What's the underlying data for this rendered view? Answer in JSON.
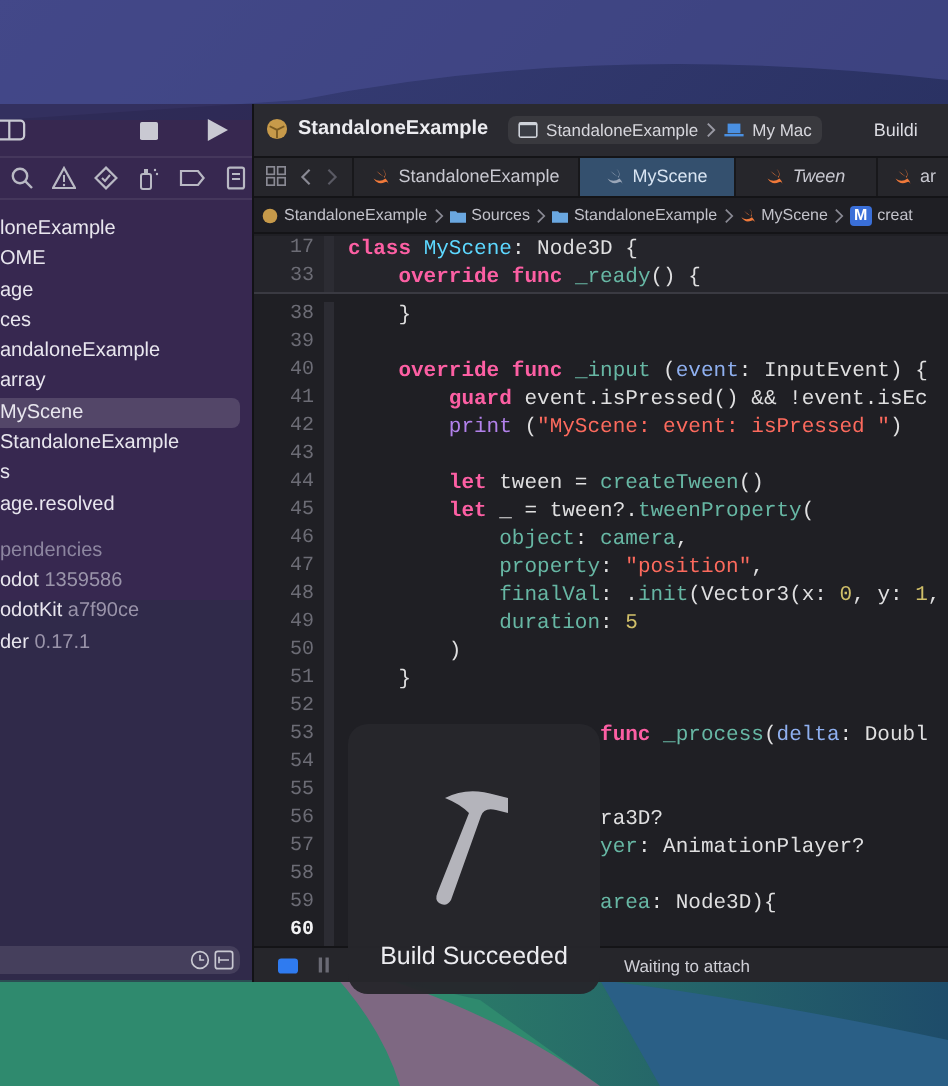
{
  "toolbar": {
    "project_title": "StandaloneExample",
    "scheme": "StandaloneExample",
    "destination": "My Mac",
    "status": "Buildi"
  },
  "navigator": {
    "items": [
      {
        "label": "loneExample",
        "selected": false
      },
      {
        "label": "OME",
        "selected": false
      },
      {
        "label": "age",
        "selected": false
      },
      {
        "label": "ces",
        "selected": false
      },
      {
        "label": "andaloneExample",
        "selected": false
      },
      {
        "label": "array",
        "selected": false
      },
      {
        "label": "MyScene",
        "selected": true
      },
      {
        "label": "StandaloneExample",
        "selected": false
      },
      {
        "label": "s",
        "selected": false
      },
      {
        "label": "age.resolved",
        "selected": false
      }
    ],
    "dependencies_header": "pendencies",
    "packages": [
      {
        "name": "odot",
        "version": "1359586"
      },
      {
        "name": "odotKit",
        "version": "a7f90ce"
      },
      {
        "name": "der",
        "version": "0.17.1"
      }
    ]
  },
  "tabs": [
    {
      "label": "StandaloneExample",
      "selected": false,
      "preview": false
    },
    {
      "label": "MyScene",
      "selected": true,
      "preview": false
    },
    {
      "label": "Tween",
      "selected": false,
      "preview": true
    },
    {
      "label": "ar",
      "selected": false,
      "preview": false
    }
  ],
  "jump_bar": [
    {
      "kind": "project",
      "label": "StandaloneExample"
    },
    {
      "kind": "folder",
      "label": "Sources"
    },
    {
      "kind": "folder",
      "label": "StandaloneExample"
    },
    {
      "kind": "swift",
      "label": "MyScene"
    },
    {
      "kind": "method",
      "badge": "M",
      "label": "creat"
    }
  ],
  "editor": {
    "sticky_lines": [
      {
        "number": "17",
        "tokens": [
          {
            "kind": "keyword",
            "text": "class"
          },
          {
            "kind": "decl",
            "text": " MyScene"
          },
          {
            "kind": "plain",
            "text": ": Node3D {"
          }
        ]
      },
      {
        "number": "33",
        "tokens": [
          {
            "kind": "keyword",
            "text": "    override"
          },
          {
            "kind": "keyword",
            "text": " func"
          },
          {
            "kind": "func",
            "text": " _ready"
          },
          {
            "kind": "plain",
            "text": "() {"
          }
        ]
      }
    ],
    "lines": [
      {
        "number": "38",
        "current": false,
        "tokens": [
          {
            "kind": "plain",
            "text": "    }"
          }
        ]
      },
      {
        "number": "39",
        "current": false
      },
      {
        "number": "40",
        "current": false,
        "tokens": [
          {
            "kind": "keyword",
            "text": "    override"
          },
          {
            "kind": "keyword",
            "text": " func"
          },
          {
            "kind": "func",
            "text": " _input"
          },
          {
            "kind": "plain",
            "text": " ("
          },
          {
            "kind": "param",
            "text": "event"
          },
          {
            "kind": "plain",
            "text": ": InputEvent) {"
          }
        ]
      },
      {
        "number": "41",
        "current": false,
        "tokens": [
          {
            "kind": "keyword",
            "text": "        guard"
          },
          {
            "kind": "plain",
            "text": " event.isPressed() && !event.isEc"
          }
        ]
      },
      {
        "number": "42",
        "current": false,
        "tokens": [
          {
            "kind": "builtin",
            "text": "        print"
          },
          {
            "kind": "plain",
            "text": " ("
          },
          {
            "kind": "string",
            "text": "\"MyScene: event: isPressed \""
          },
          {
            "kind": "plain",
            "text": ")"
          }
        ]
      },
      {
        "number": "43",
        "current": false
      },
      {
        "number": "44",
        "current": false,
        "tokens": [
          {
            "kind": "keyword",
            "text": "        let"
          },
          {
            "kind": "plain",
            "text": " tween = "
          },
          {
            "kind": "func",
            "text": "createTween"
          },
          {
            "kind": "plain",
            "text": "()"
          }
        ]
      },
      {
        "number": "45",
        "current": false,
        "tokens": [
          {
            "kind": "keyword",
            "text": "        let"
          },
          {
            "kind": "plain",
            "text": " _ = tween?."
          },
          {
            "kind": "func",
            "text": "tweenProperty"
          },
          {
            "kind": "plain",
            "text": "("
          }
        ]
      },
      {
        "number": "46",
        "current": false,
        "tokens": [
          {
            "kind": "func",
            "text": "            object"
          },
          {
            "kind": "plain",
            "text": ": "
          },
          {
            "kind": "func",
            "text": "camera"
          },
          {
            "kind": "plain",
            "text": ","
          }
        ]
      },
      {
        "number": "47",
        "current": false,
        "tokens": [
          {
            "kind": "func",
            "text": "            property"
          },
          {
            "kind": "plain",
            "text": ": "
          },
          {
            "kind": "string",
            "text": "\"position\""
          },
          {
            "kind": "plain",
            "text": ","
          }
        ]
      },
      {
        "number": "48",
        "current": false,
        "tokens": [
          {
            "kind": "func",
            "text": "            finalVal"
          },
          {
            "kind": "plain",
            "text": ": ."
          },
          {
            "kind": "func",
            "text": "init"
          },
          {
            "kind": "plain",
            "text": "(Vector3(x: "
          },
          {
            "kind": "number",
            "text": "0"
          },
          {
            "kind": "plain",
            "text": ", y: "
          },
          {
            "kind": "number",
            "text": "1"
          },
          {
            "kind": "plain",
            "text": ","
          }
        ]
      },
      {
        "number": "49",
        "current": false,
        "tokens": [
          {
            "kind": "func",
            "text": "            duration"
          },
          {
            "kind": "plain",
            "text": ": "
          },
          {
            "kind": "number",
            "text": "5"
          }
        ]
      },
      {
        "number": "50",
        "current": false,
        "tokens": [
          {
            "kind": "plain",
            "text": "        )"
          }
        ]
      },
      {
        "number": "51",
        "current": false,
        "tokens": [
          {
            "kind": "plain",
            "text": "    }"
          }
        ]
      },
      {
        "number": "52",
        "current": false
      },
      {
        "number": "53",
        "current": false,
        "tokens": [
          {
            "kind": "keyword",
            "text": "                    func"
          },
          {
            "kind": "func",
            "text": " _process"
          },
          {
            "kind": "plain",
            "text": "("
          },
          {
            "kind": "param",
            "text": "delta"
          },
          {
            "kind": "plain",
            "text": ": Doubl"
          }
        ]
      },
      {
        "number": "54",
        "current": false
      },
      {
        "number": "55",
        "current": false
      },
      {
        "number": "56",
        "current": false,
        "tokens": [
          {
            "kind": "plain",
            "text": "                    ra3D?"
          }
        ]
      },
      {
        "number": "57",
        "current": false,
        "tokens": [
          {
            "kind": "func",
            "text": "                    yer"
          },
          {
            "kind": "plain",
            "text": ": AnimationPlayer?"
          }
        ]
      },
      {
        "number": "58",
        "current": false
      },
      {
        "number": "59",
        "current": false,
        "tokens": [
          {
            "kind": "func",
            "text": "                    area"
          },
          {
            "kind": "plain",
            "text": ": Node3D){"
          }
        ]
      },
      {
        "number": "60",
        "current": true
      }
    ]
  },
  "status_bar": {
    "message": "Waiting to attach"
  },
  "hud": {
    "message": "Build Succeeded"
  }
}
